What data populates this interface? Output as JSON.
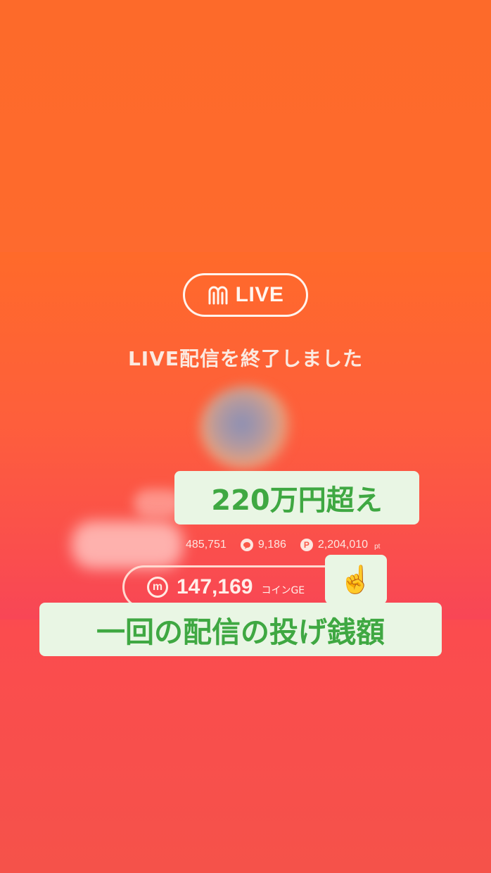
{
  "header": {
    "logo_text": "LIVE"
  },
  "status_text": "LIVE配信を終了しました",
  "stats": {
    "viewers": "485,751",
    "comments": "9,186",
    "points": "2,204,010",
    "points_unit": "pt",
    "points_icon_letter": "P"
  },
  "coins": {
    "icon_letter": "m",
    "value": "147,169",
    "unit": "コインGE"
  },
  "captions": {
    "top": "220万円超え",
    "pointer_emoji": "☝️",
    "bottom": "一回の配信の投げ銭額"
  },
  "colors": {
    "background_top": "#fd6a2a",
    "background_bottom": "#f5524a",
    "caption_bg": "#e9f6e4",
    "caption_text": "#3fa842"
  }
}
